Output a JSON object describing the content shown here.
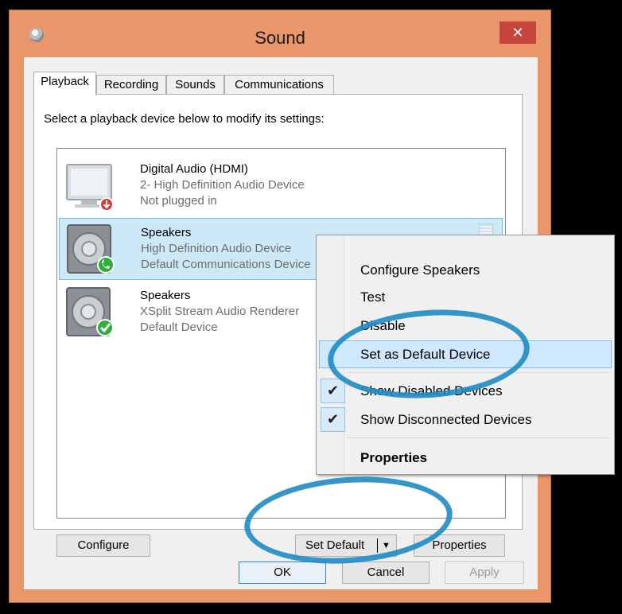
{
  "window": {
    "title": "Sound",
    "close_label": "✕"
  },
  "tabs": [
    {
      "label": "Playback"
    },
    {
      "label": "Recording"
    },
    {
      "label": "Sounds"
    },
    {
      "label": "Communications"
    }
  ],
  "panel": {
    "instruction": "Select a playback device below to modify its settings:"
  },
  "devices": [
    {
      "name": "Digital Audio (HDMI)",
      "line1": "2- High Definition Audio Device",
      "line2": "Not plugged in",
      "icon": "monitor-icon",
      "badge": "red-unplugged-badge"
    },
    {
      "name": "Speakers",
      "line1": "High Definition Audio Device",
      "line2": "Default Communications Device",
      "icon": "speaker-icon",
      "badge": "green-phone-badge",
      "selected": true
    },
    {
      "name": "Speakers",
      "line1": "XSplit Stream Audio Renderer",
      "line2": "Default Device",
      "icon": "speaker-icon",
      "badge": "green-check-badge"
    }
  ],
  "buttons": {
    "configure": "Configure",
    "set_default": "Set Default",
    "properties": "Properties",
    "ok": "OK",
    "cancel": "Cancel",
    "apply": "Apply"
  },
  "context_menu": {
    "items": [
      {
        "label": "Configure Speakers"
      },
      {
        "label": "Test"
      },
      {
        "label": "Disable"
      },
      {
        "label": "Set as Default Device"
      },
      {
        "label": "Show Disabled Devices",
        "checked": true
      },
      {
        "label": "Show Disconnected Devices",
        "checked": true
      },
      {
        "label": "Properties"
      }
    ]
  },
  "colors": {
    "window_frame": "#e8966a",
    "selection": "#cde8f7",
    "annotation": "#1e8bc3"
  }
}
